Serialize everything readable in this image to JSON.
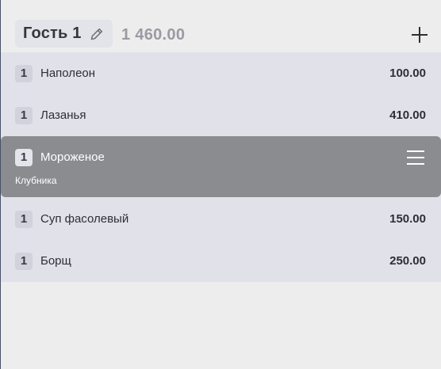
{
  "guest": {
    "name": "Гость 1",
    "total": "1 460.00"
  },
  "icons": {
    "edit": "pencil-icon",
    "add": "plus-icon",
    "menu": "hamburger-icon"
  },
  "colors": {
    "selected_row": "#8b8c90",
    "list_background": "#e1e1ea",
    "page_background": "#ededed"
  },
  "items": [
    {
      "qty": "1",
      "name": "Наполеон",
      "price": "100.00"
    },
    {
      "qty": "1",
      "name": "Лазанья",
      "price": "410.00"
    },
    {
      "qty": "1",
      "name": "Мороженое",
      "modifier": "Клубника",
      "selected": true
    },
    {
      "qty": "1",
      "name": "Суп фасолевый",
      "price": "150.00"
    },
    {
      "qty": "1",
      "name": "Борщ",
      "price": "250.00"
    }
  ]
}
